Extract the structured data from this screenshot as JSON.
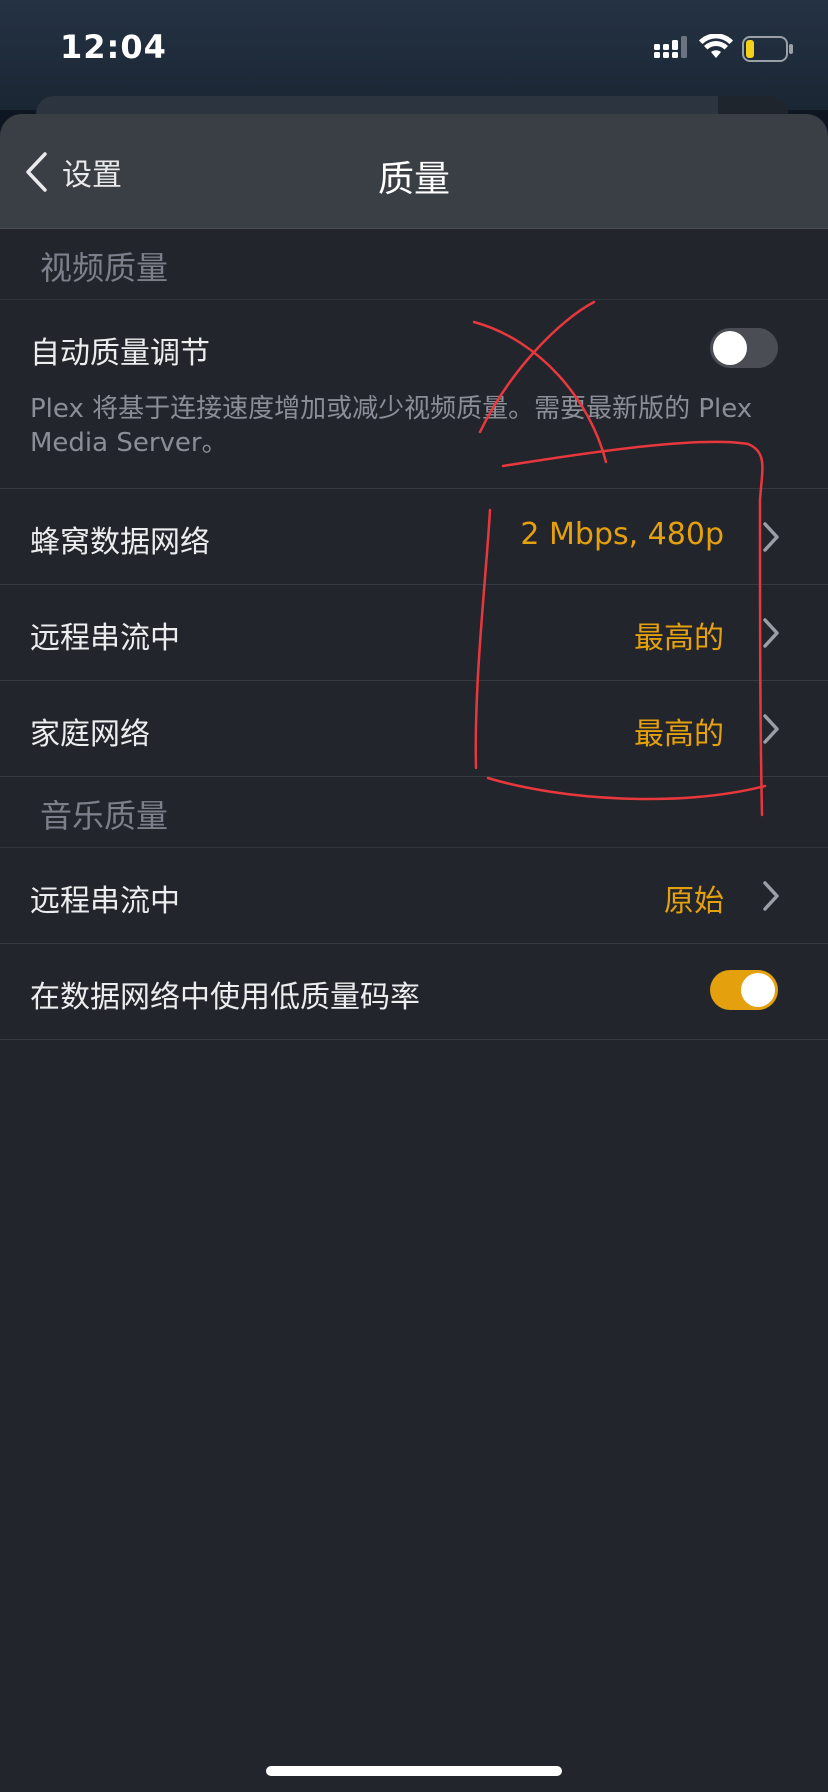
{
  "status_bar": {
    "time": "12:04"
  },
  "nav": {
    "back_label": "设置",
    "title": "质量"
  },
  "video_section": {
    "header": "视频质量",
    "auto_quality": {
      "label": "自动质量调节",
      "description": "Plex 将基于连接速度增加或减少视频质量。需要最新版的 Plex Media Server。",
      "enabled": false
    },
    "rows": [
      {
        "label": "蜂窝数据网络",
        "value": "2 Mbps, 480p"
      },
      {
        "label": "远程串流中",
        "value": "最高的"
      },
      {
        "label": "家庭网络",
        "value": "最高的"
      }
    ]
  },
  "music_section": {
    "header": "音乐质量",
    "remote_streaming": {
      "label": "远程串流中",
      "value": "原始"
    },
    "low_bitrate": {
      "label": "在数据网络中使用低质量码率",
      "enabled": true
    }
  },
  "colors": {
    "accent": "#e5a00d",
    "annotation": "#e8383d"
  }
}
